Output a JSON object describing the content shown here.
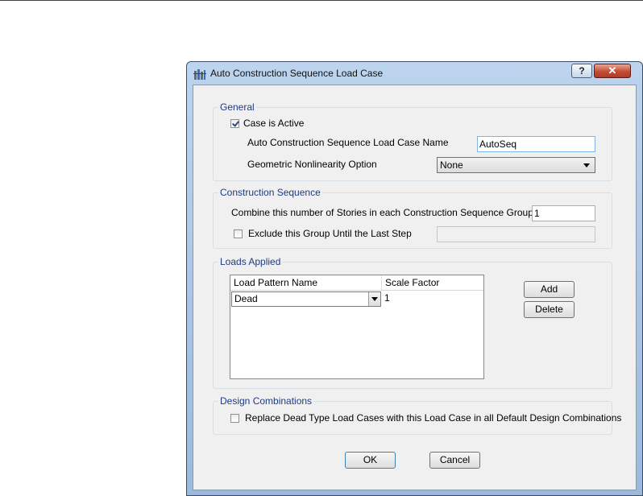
{
  "window": {
    "title": "Auto Construction Sequence Load Case",
    "help_label": "?",
    "close_label": "✕",
    "icon": "app-icon"
  },
  "general": {
    "legend": "General",
    "case_active_label": "Case is Active",
    "case_active_checked": true,
    "name_label": "Auto Construction Sequence Load Case Name",
    "name_value": "AutoSeq",
    "nonlinearity_label": "Geometric Nonlinearity Option",
    "nonlinearity_value": "None"
  },
  "construction_sequence": {
    "legend": "Construction Sequence",
    "combine_label": "Combine this number of Stories in each Construction Sequence Group",
    "combine_value": "1",
    "exclude_label": "Exclude this Group Until the Last Step",
    "exclude_checked": false,
    "exclude_value": ""
  },
  "loads_applied": {
    "legend": "Loads Applied",
    "columns": [
      "Load Pattern Name",
      "Scale Factor"
    ],
    "rows": [
      {
        "pattern": "Dead",
        "scale": "1"
      }
    ],
    "add_label": "Add",
    "delete_label": "Delete"
  },
  "design_combinations": {
    "legend": "Design Combinations",
    "replace_label": "Replace Dead Type Load Cases with this Load Case in all Default Design Combinations",
    "replace_checked": false
  },
  "footer": {
    "ok_label": "OK",
    "cancel_label": "Cancel"
  }
}
